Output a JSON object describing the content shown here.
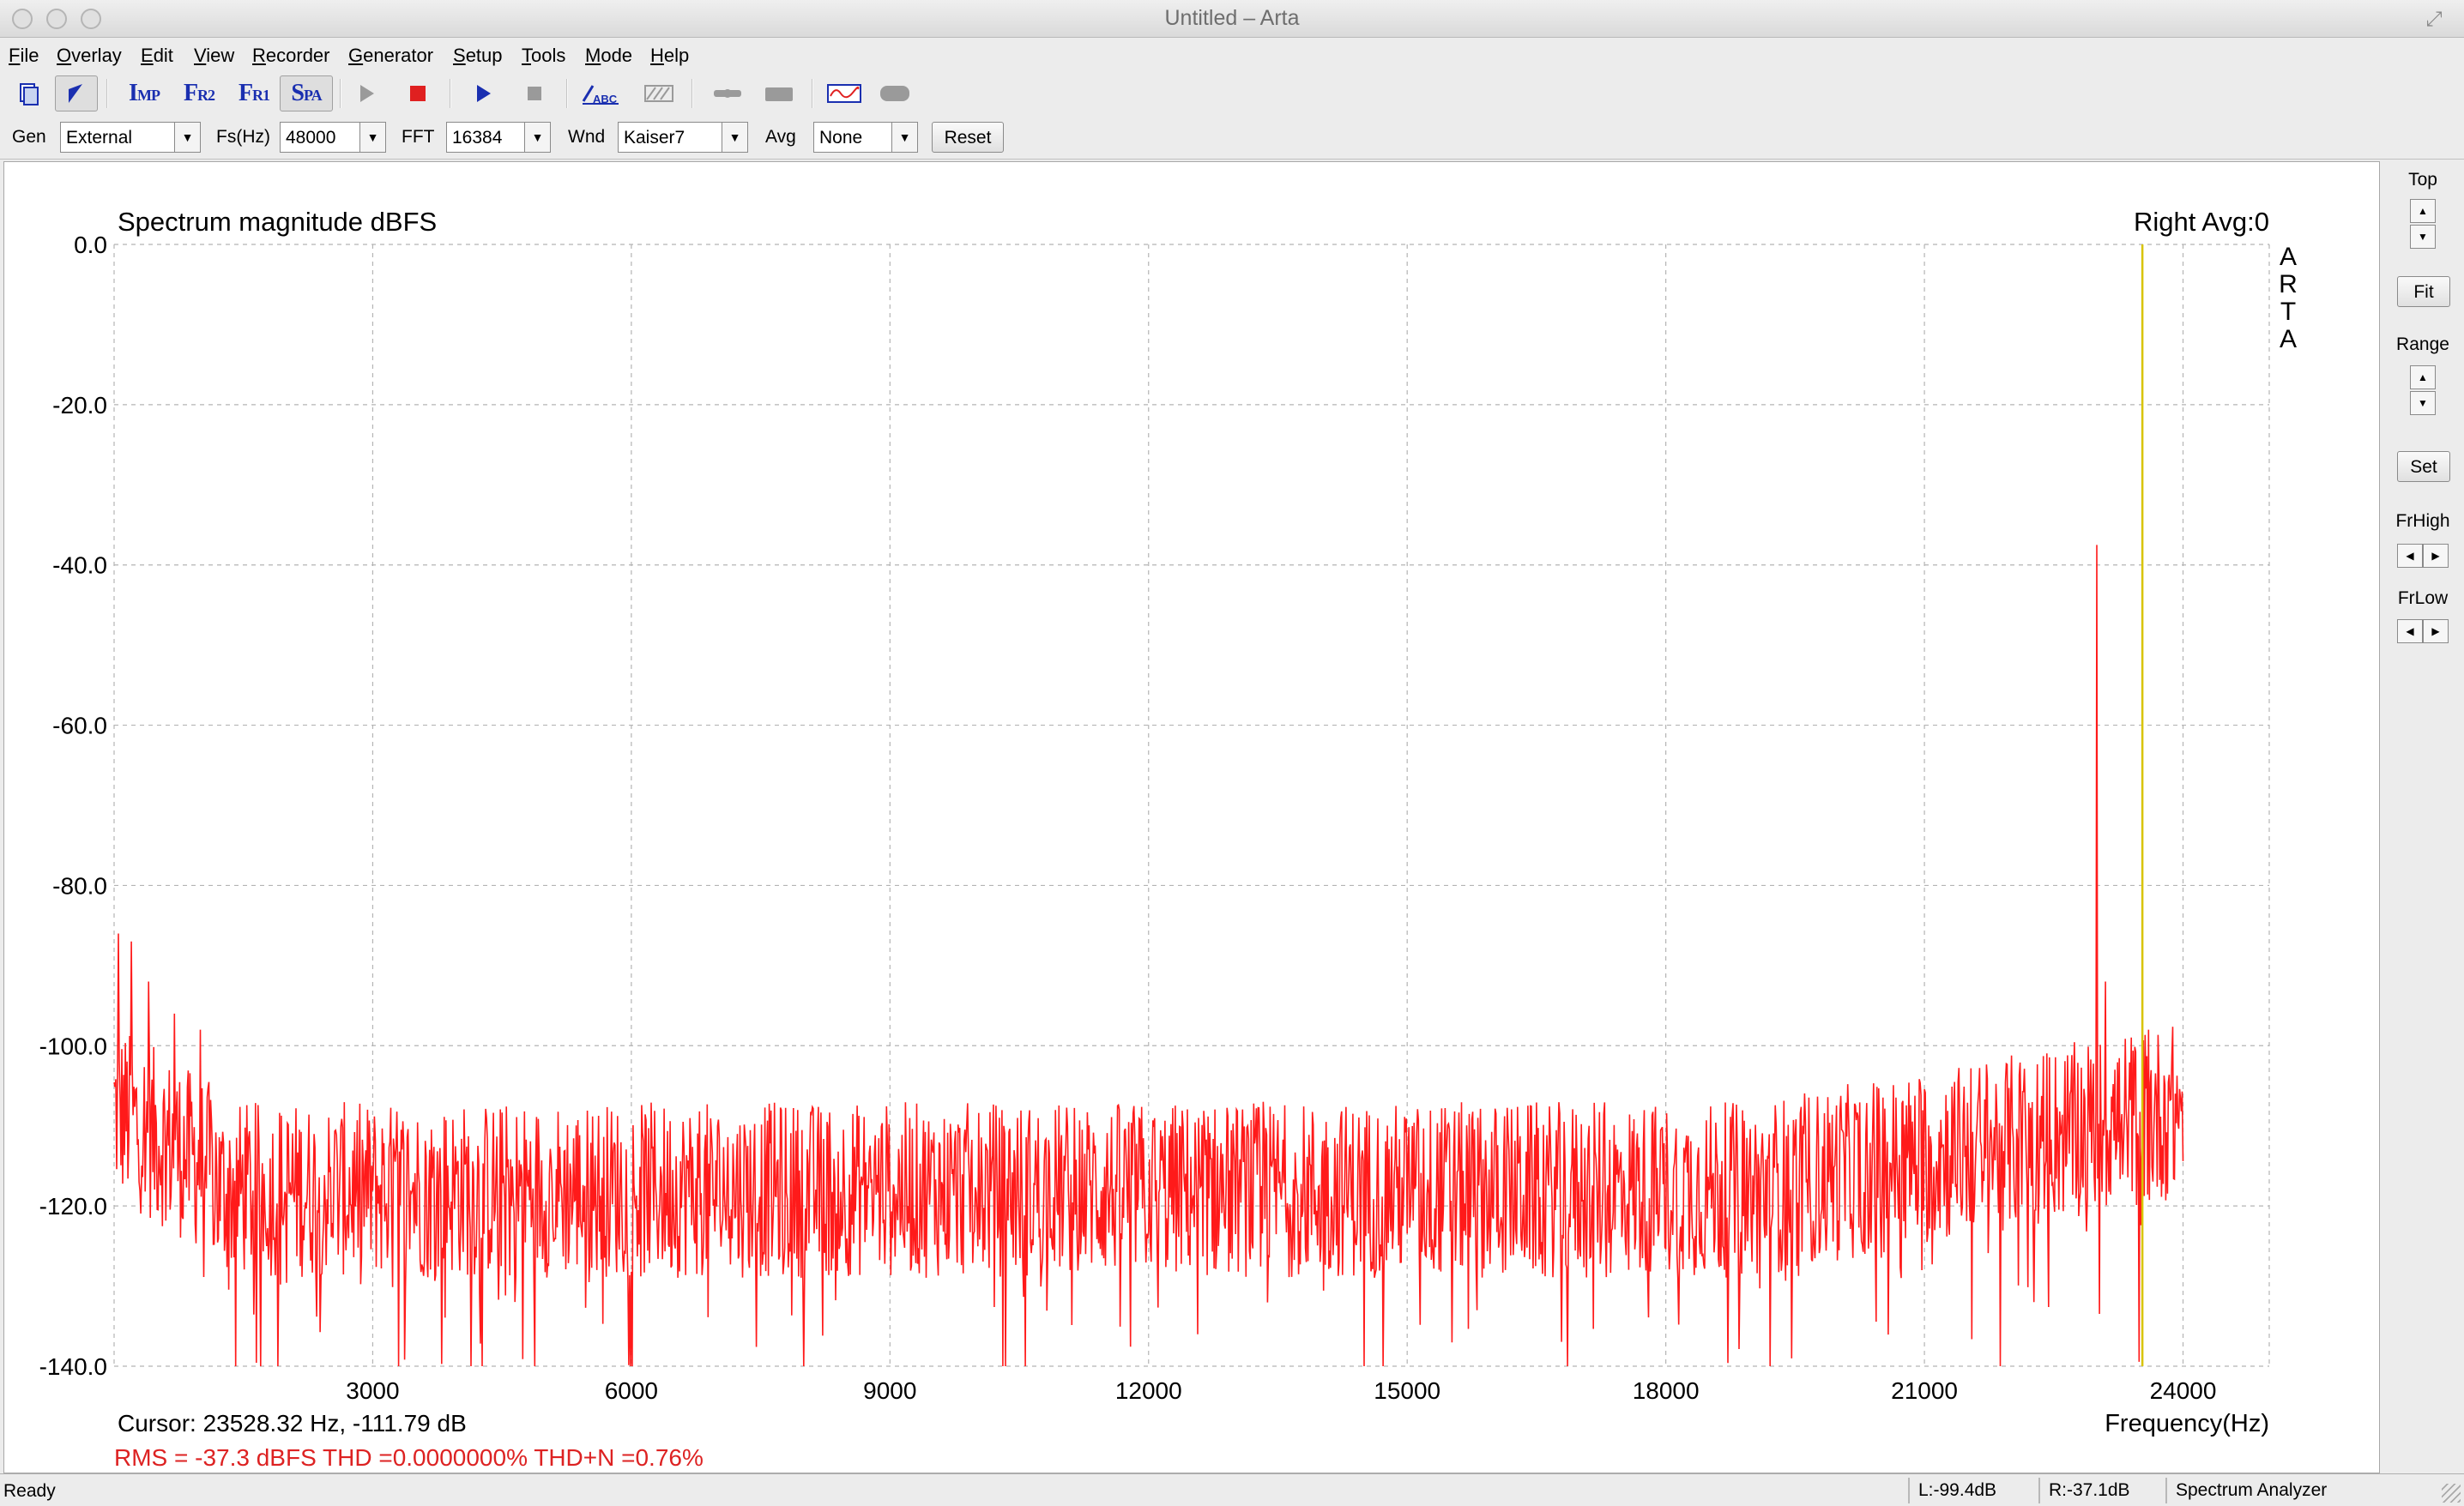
{
  "window": {
    "title": "Untitled – Arta"
  },
  "menu": [
    {
      "label": "File",
      "u": "F",
      "rest": "ile"
    },
    {
      "label": "Overlay",
      "u": "O",
      "rest": "verlay"
    },
    {
      "label": "Edit",
      "u": "E",
      "rest": "dit"
    },
    {
      "label": "View",
      "u": "V",
      "rest": "iew"
    },
    {
      "label": "Recorder",
      "u": "R",
      "rest": "ecorder"
    },
    {
      "label": "Generator",
      "u": "G",
      "rest": "enerator"
    },
    {
      "label": "Setup",
      "u": "S",
      "rest": "etup"
    },
    {
      "label": "Tools",
      "u": "T",
      "rest": "ools"
    },
    {
      "label": "Mode",
      "u": "M",
      "rest": "ode"
    },
    {
      "label": "Help",
      "u": "H",
      "rest": "elp"
    }
  ],
  "toolbar": {
    "imp": {
      "big": "I",
      "small": "MP"
    },
    "fr2": {
      "big": "F",
      "small": "R2"
    },
    "fr1": {
      "big": "F",
      "small": "R1"
    },
    "spa": {
      "big": "S",
      "small": "PA"
    },
    "abc": "ABC"
  },
  "params": {
    "gen_label": "Gen",
    "gen_value": "External",
    "fs_label": "Fs(Hz)",
    "fs_value": "48000",
    "fft_label": "FFT",
    "fft_value": "16384",
    "wnd_label": "Wnd",
    "wnd_value": "Kaiser7",
    "avg_label": "Avg",
    "avg_value": "None",
    "reset_label": "Reset"
  },
  "right_panel": {
    "top_label": "Top",
    "fit_label": "Fit",
    "range_label": "Range",
    "set_label": "Set",
    "frhigh_label": "FrHigh",
    "frlow_label": "FrLow"
  },
  "chart_data": {
    "type": "line",
    "title": "Spectrum magnitude dBFS",
    "channel_info": "Right  Avg:0",
    "brand": [
      "A",
      "R",
      "T",
      "A"
    ],
    "xlabel": "Frequency(Hz)",
    "xlim": [
      0,
      25000
    ],
    "ylim": [
      -140,
      0
    ],
    "x_ticks": [
      3000,
      6000,
      9000,
      12000,
      15000,
      18000,
      21000,
      24000
    ],
    "x_tick_labels": [
      "3000",
      "6000",
      "9000",
      "12000",
      "15000",
      "18000",
      "21000",
      "24000"
    ],
    "y_ticks": [
      0,
      -20,
      -40,
      -60,
      -80,
      -100,
      -120,
      -140
    ],
    "y_tick_labels": [
      "0.0",
      "-20.0",
      "-40.0",
      "-60.0",
      "-80.0",
      "-100.0",
      "-120.0",
      "-140.0"
    ],
    "grid": true,
    "grid_style": "dashed",
    "trace_color": "#ff1a1a",
    "cursor_color": "#d8c400",
    "cursor_freq": 23528.32,
    "cursor_text": "Cursor: 23528.32 Hz, -111.79 dB",
    "stats_text": "RMS =  -37.3 dBFS   THD =0.0000000%   THD+N =0.76%",
    "stats_color": "#dd2222",
    "series": [
      {
        "noise_floor_db": -118,
        "peaks": [
          {
            "x": 23000,
            "y": -37.5
          },
          {
            "x": 50,
            "y": -86
          },
          {
            "x": 200,
            "y": -87
          },
          {
            "x": 400,
            "y": -92
          },
          {
            "x": 700,
            "y": -96
          },
          {
            "x": 1000,
            "y": -98
          },
          {
            "x": 23100,
            "y": -92
          },
          {
            "x": 23600,
            "y": -98
          }
        ],
        "x_end": 24000
      }
    ]
  },
  "status": {
    "ready": "Ready",
    "left_level": "L:-99.4dB",
    "right_level": "R:-37.1dB",
    "mode": "Spectrum Analyzer"
  }
}
